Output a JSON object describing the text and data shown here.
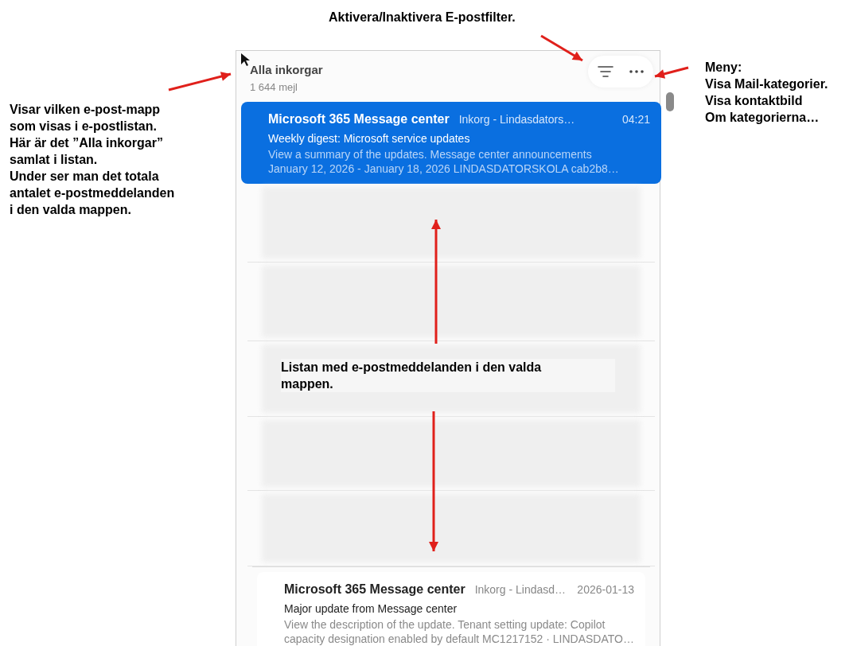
{
  "mailbox": {
    "title": "Alla inkorgar",
    "count": "1 644 mejl"
  },
  "messages": [
    {
      "kind": "message",
      "selected": true,
      "sender": "Microsoft 365 Message center",
      "folder": "Inkorg - Lindasdators…",
      "time": "04:21",
      "subject": "Weekly digest: Microsoft service updates",
      "preview_lines": [
        "View a summary of the updates. Message center announcements",
        "January 12, 2026 - January 18, 2026 LINDASDATORSKOLA cab2b8…"
      ]
    },
    {
      "kind": "hidden"
    },
    {
      "kind": "hidden"
    },
    {
      "kind": "hidden"
    },
    {
      "kind": "hidden"
    },
    {
      "kind": "hidden"
    },
    {
      "kind": "message",
      "selected": false,
      "sender": "Microsoft 365 Message center",
      "folder": "Inkorg - Lindasd…",
      "time": "2026-01-13",
      "subject": "Major update from Message center",
      "preview_lines": [
        "View the description of the update. Tenant setting update: Copilot",
        "capacity designation enabled by default MC1217152 · LINDASDATO…"
      ]
    }
  ],
  "annotations": [
    {
      "lines": [
        "Aktivera/Inaktivera E-postfilter."
      ]
    },
    {
      "lines": [
        "Meny:",
        "Visa Mail-kategorier.",
        "Visa kontaktbild",
        "Om kategorierna…"
      ]
    },
    {
      "lines": [
        "Visar vilken e-post-mapp",
        "som visas i e-postlistan.",
        "Här är det ”Alla inkorgar”",
        "samlat i listan.",
        "Under ser man det totala",
        "antalet e-postmeddelanden",
        "i den valda mappen."
      ]
    },
    {
      "lines": [
        "Listan med e-postmeddelanden i den valda",
        "mappen."
      ]
    }
  ]
}
